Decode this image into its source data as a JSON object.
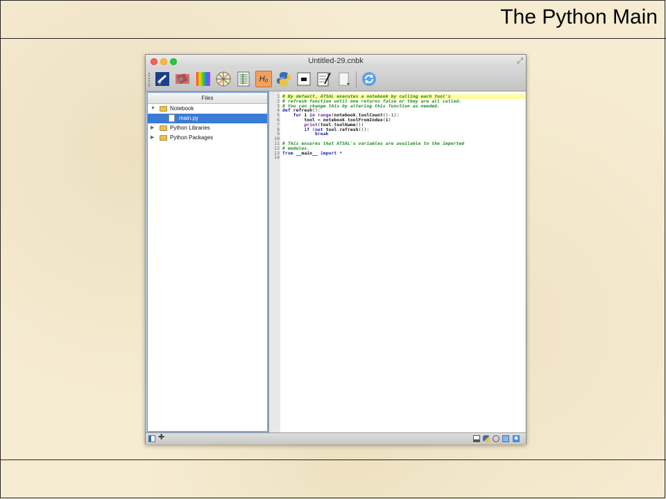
{
  "slide": {
    "title": "The Python Main"
  },
  "window": {
    "title": "Untitled-29.cnbk"
  },
  "toolbar": {
    "buttons": [
      {
        "name": "telescope-tool-icon"
      },
      {
        "name": "color-swatch-tool-icon"
      },
      {
        "name": "spectrum-tool-icon"
      },
      {
        "name": "pie-diagram-tool-icon"
      },
      {
        "name": "table-tool-icon"
      },
      {
        "name": "hypothesis-tool-icon",
        "label": "H₀"
      },
      {
        "name": "python-tool-icon"
      },
      {
        "name": "terminal-tool-icon"
      },
      {
        "name": "notepad-edit-tool-icon"
      },
      {
        "name": "document-tool-icon"
      },
      {
        "name": "refresh-tool-icon"
      }
    ]
  },
  "files_panel": {
    "header": "Files",
    "tree": [
      {
        "label": "Notebook",
        "expanded": true,
        "type": "folder"
      },
      {
        "label": "main.py",
        "type": "file",
        "selected": true
      },
      {
        "label": "Python Libraries",
        "expanded": false,
        "type": "folder"
      },
      {
        "label": "Python Packages",
        "expanded": false,
        "type": "folder"
      }
    ]
  },
  "editor": {
    "line_numbers": [
      "1",
      "2",
      "3",
      "4",
      "5",
      "6",
      "7",
      "8",
      "9",
      "10",
      "11",
      "12",
      "13",
      "14"
    ],
    "lines": [
      "# By default, ATSAL executes a notebook by calling each tool's",
      "# refresh function until one returns false or they are all called.",
      "# You can change this by altering this function as needed.",
      "def refresh():",
      "    for i in range(notebook.toolCount()-1):",
      "        tool = notebook.toolFromIndex(i)",
      "        print(tool.toolName())",
      "        if (not tool.refresh()):",
      "            break",
      "",
      "# This ensures that ATSAL's variables are available to the imported",
      "# modules.",
      "from __main__ import *",
      ""
    ],
    "highlighted_line": 1
  },
  "colors": {
    "slide_background": "#f6ecd2",
    "selection_blue": "#3a7bd5",
    "comment_green": "#1f8a1f",
    "keyword_blue": "#2222aa",
    "highlight_yellow": "#fefca0"
  }
}
